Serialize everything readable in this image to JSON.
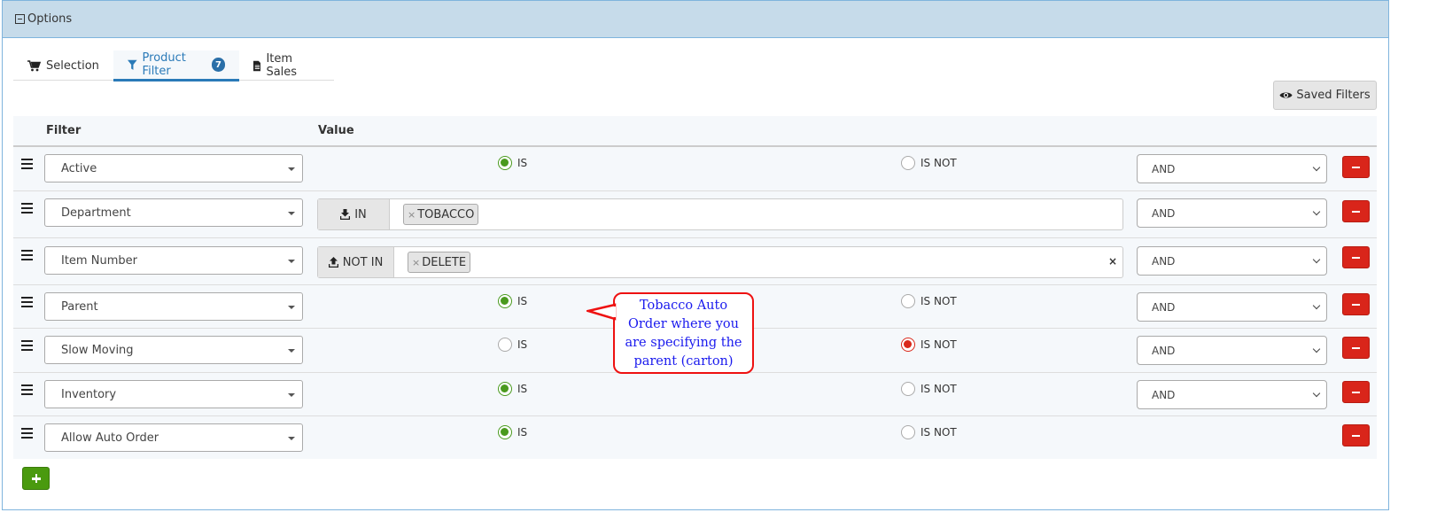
{
  "panel": {
    "title": "Options",
    "toggle_icon": "minus-square-icon"
  },
  "tabs": [
    {
      "label": "Selection",
      "icon": "shopping-cart-icon",
      "active": false
    },
    {
      "label": "Product Filter",
      "icon": "filter-icon",
      "active": true,
      "badge": "7"
    },
    {
      "label": "Item Sales",
      "icon": "file-icon",
      "active": false
    }
  ],
  "saved_filters": {
    "label": "Saved Filters",
    "icon": "eye-icon"
  },
  "table": {
    "headers": {
      "filter": "Filter",
      "value": "Value"
    },
    "rows": [
      {
        "filter": "Active",
        "type": "radio",
        "is_label": "IS",
        "is_not_label": "IS NOT",
        "selected": "IS",
        "conjunction": "AND"
      },
      {
        "filter": "Department",
        "type": "multi",
        "operator": "IN",
        "operator_icon": "download-icon",
        "values": [
          "TOBACCO"
        ],
        "conjunction": "AND"
      },
      {
        "filter": "Item Number",
        "type": "multi",
        "operator": "NOT IN",
        "operator_icon": "upload-icon",
        "values": [
          "DELETE"
        ],
        "clear": "×",
        "conjunction": "AND"
      },
      {
        "filter": "Parent",
        "type": "radio",
        "is_label": "IS",
        "is_not_label": "IS NOT",
        "selected": "IS",
        "conjunction": "AND"
      },
      {
        "filter": "Slow Moving",
        "type": "radio",
        "is_label": "IS",
        "is_not_label": "IS NOT",
        "selected": "IS NOT",
        "conjunction": "AND"
      },
      {
        "filter": "Inventory",
        "type": "radio",
        "is_label": "IS",
        "is_not_label": "IS NOT",
        "selected": "IS",
        "conjunction": "AND"
      },
      {
        "filter": "Allow Auto Order",
        "type": "radio",
        "is_label": "IS",
        "is_not_label": "IS NOT",
        "selected": "IS",
        "conjunction": null
      }
    ]
  },
  "chip_remove": "×",
  "callout": {
    "lines": [
      "Tobacco Auto",
      "Order where you",
      "are specifying the",
      "parent (carton)"
    ],
    "text_color": "#1a1aee",
    "border_color": "#ee1111"
  },
  "colors": {
    "accent": "#2a7ab8",
    "remove": "#d9251a",
    "add": "#4a9a0e",
    "radio_on_green": "#4a9a1e",
    "radio_on_red": "#d9281b",
    "header_bg": "#c6dbea"
  }
}
